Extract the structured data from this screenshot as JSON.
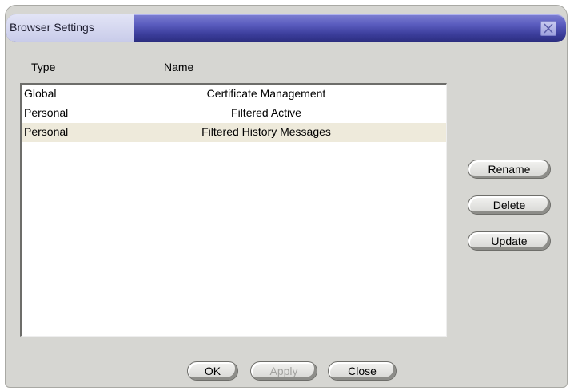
{
  "window": {
    "title": "Browser Settings"
  },
  "columns": {
    "type": "Type",
    "name": "Name"
  },
  "rows": [
    {
      "type": "Global",
      "name": "Certificate Management",
      "selected": false
    },
    {
      "type": "Personal",
      "name": "Filtered Active",
      "selected": false
    },
    {
      "type": "Personal",
      "name": "Filtered History Messages",
      "selected": true
    }
  ],
  "side_buttons": {
    "rename": "Rename",
    "delete": "Delete",
    "update": "Update"
  },
  "bottom_buttons": {
    "ok": "OK",
    "apply": "Apply",
    "close": "Close"
  },
  "icons": {
    "close": "close-x-icon"
  },
  "colors": {
    "title_bar": "#3c3e9c",
    "selected_row": "#eeeadb",
    "dialog_bg": "#d6d6d2"
  }
}
